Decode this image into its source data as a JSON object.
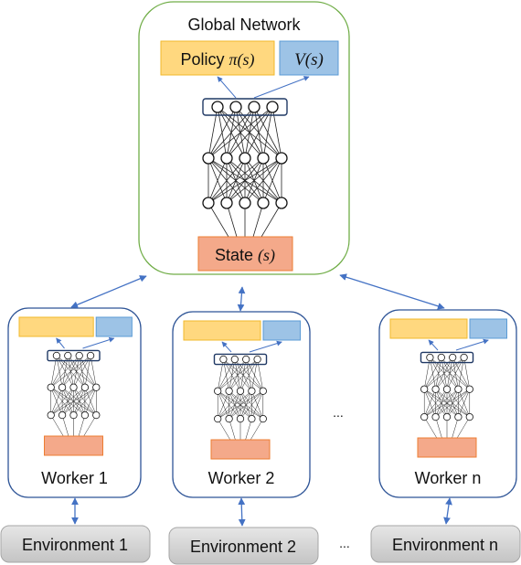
{
  "global": {
    "title": "Global Network",
    "policy_label": "Policy ",
    "policy_math": "π(s)",
    "value_math": "V(s)",
    "state_label": "State ",
    "state_math": "(s)",
    "layers": [
      4,
      5,
      5
    ]
  },
  "workers": [
    {
      "label": "Worker 1"
    },
    {
      "label": "Worker 2"
    },
    {
      "label": "Worker n"
    }
  ],
  "environments": [
    {
      "label": "Environment 1"
    },
    {
      "label": "Environment 2"
    },
    {
      "label": "Environment n"
    }
  ],
  "ellipsis": "...",
  "colors": {
    "global_border": "#70ad47",
    "worker_border": "#2f5597",
    "policy_fill": "#ffd87f",
    "policy_border": "#f2b92b",
    "value_fill": "#9dc3e6",
    "value_border": "#5b9bd5",
    "state_fill": "#f4a98a",
    "state_border": "#ed7d31",
    "arrow": "#4472c4",
    "env_fill": "#d0d0d0",
    "env_border": "#a6a6a6"
  }
}
